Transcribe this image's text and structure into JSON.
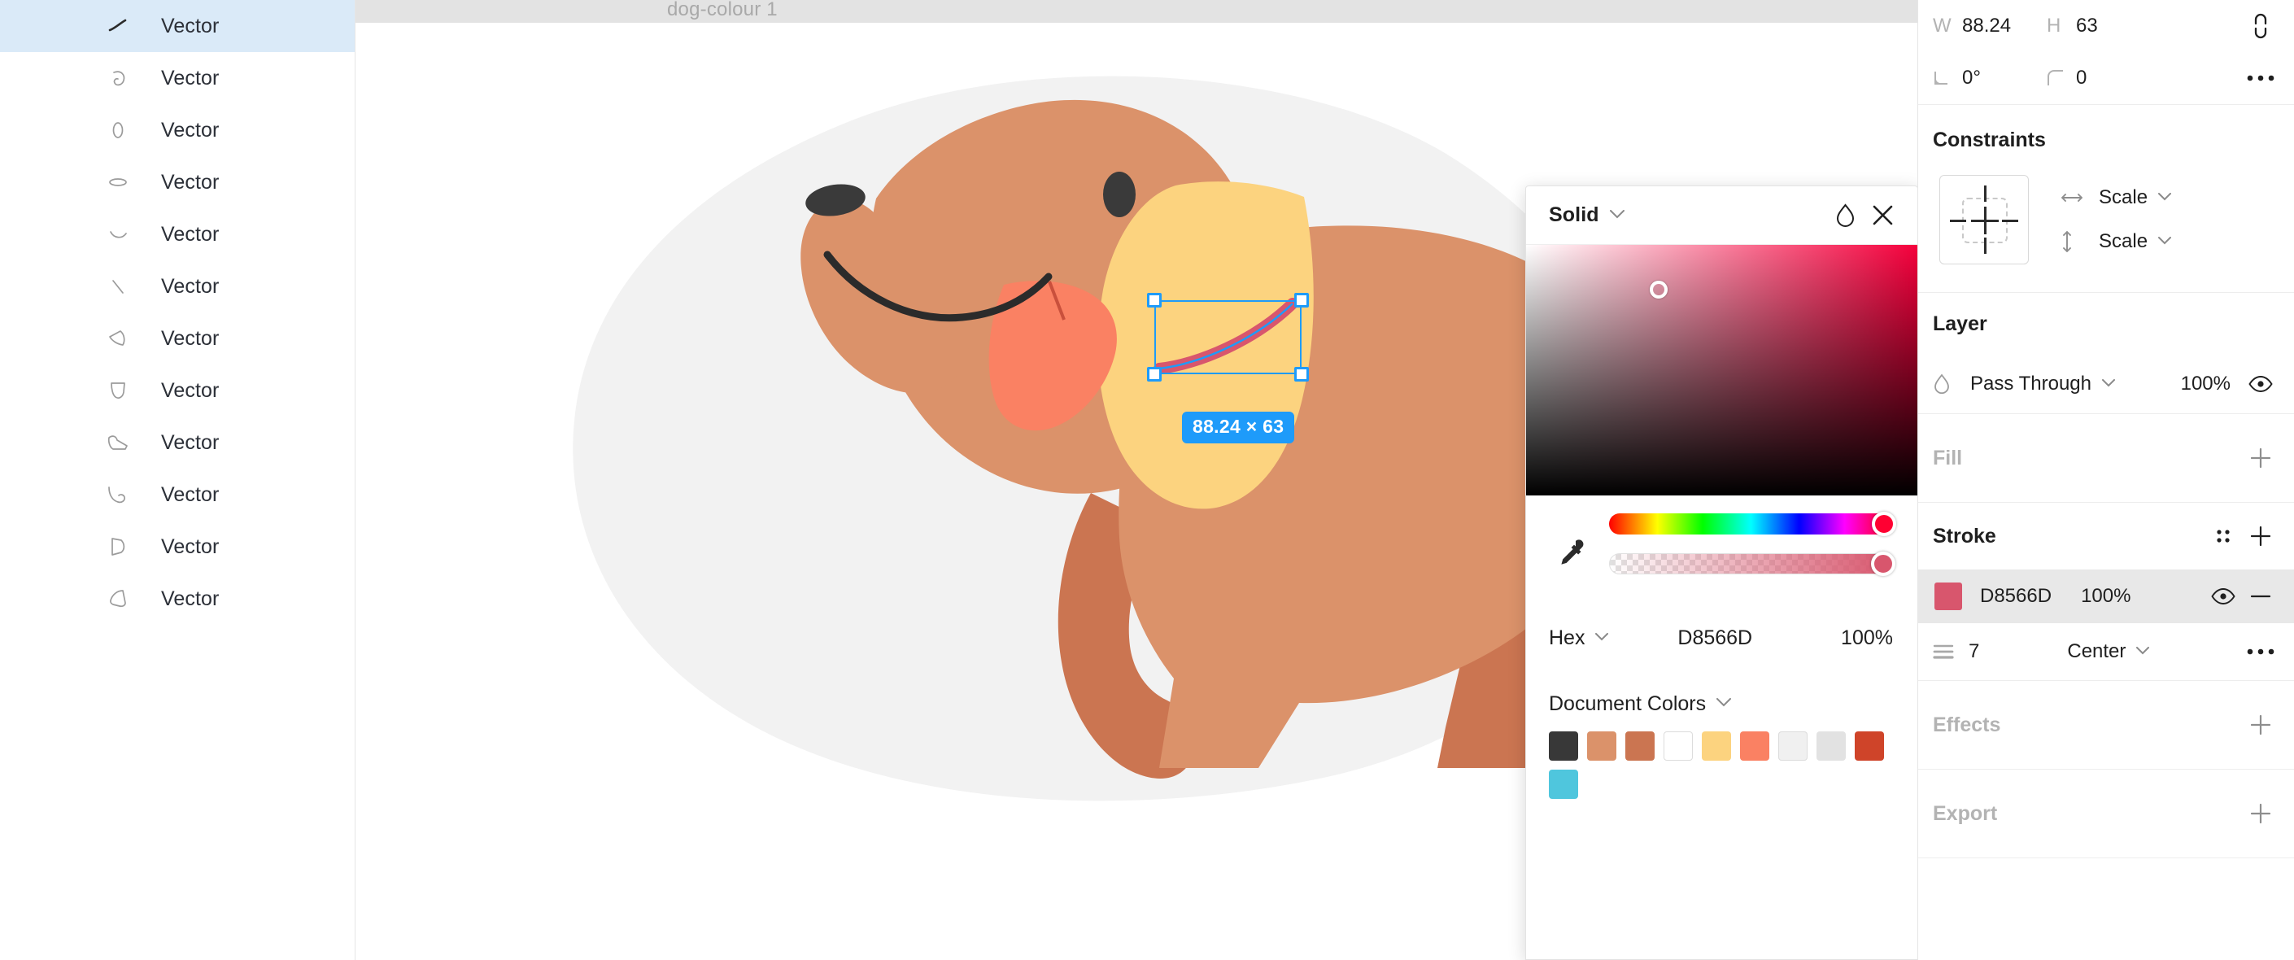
{
  "layers_panel": {
    "items": [
      {
        "name": "Vector",
        "shape": "stroke-curve",
        "selected": true
      },
      {
        "name": "Vector",
        "shape": "ear-curl",
        "selected": false
      },
      {
        "name": "Vector",
        "shape": "small-oval",
        "selected": false
      },
      {
        "name": "Vector",
        "shape": "flat-ellipse",
        "selected": false
      },
      {
        "name": "Vector",
        "shape": "smile-arc",
        "selected": false
      },
      {
        "name": "Vector",
        "shape": "diagonal-line",
        "selected": false
      },
      {
        "name": "Vector",
        "shape": "wedge",
        "selected": false
      },
      {
        "name": "Vector",
        "shape": "shield",
        "selected": false
      },
      {
        "name": "Vector",
        "shape": "paw-leg",
        "selected": false
      },
      {
        "name": "Vector",
        "shape": "hook-leg",
        "selected": false
      },
      {
        "name": "Vector",
        "shape": "flag-quad",
        "selected": false
      },
      {
        "name": "Vector",
        "shape": "blob-quad",
        "selected": false
      }
    ]
  },
  "canvas": {
    "frame_label": "dog-colour 1",
    "selection_size_badge": "88.24 × 63",
    "background": "#E3E3E3",
    "artboard_background": "#FFFFFF",
    "selection_color": "#1E9BFA",
    "illustration": {
      "name": "dog-colour",
      "blob_color": "#F2F2F2",
      "body_color": "#DB926A",
      "shade_color": "#CB7551",
      "ear_color": "#FCD37F",
      "tongue_color": "#FA8163",
      "nose_color": "#3A3A3A",
      "eye_color": "#3A3A3A",
      "mouth_color": "#2B2B2B",
      "collar_color": "#D8566D"
    }
  },
  "color_picker": {
    "type_label": "Solid",
    "eyedropper_icon": "eyedropper-icon",
    "droplet_icon": "droplet-icon",
    "close_icon": "close-icon",
    "hex_mode_label": "Hex",
    "hex_value": "D8566D",
    "alpha_value": "100%",
    "document_colors_label": "Document Colors",
    "swatches": [
      {
        "hex": "#383838",
        "bordered": false
      },
      {
        "hex": "#DB926A",
        "bordered": false
      },
      {
        "hex": "#CB7551",
        "bordered": false
      },
      {
        "hex": "#FFFFFF",
        "bordered": true
      },
      {
        "hex": "#FCD37F",
        "bordered": false
      },
      {
        "hex": "#FA8163",
        "bordered": false
      },
      {
        "hex": "#F0F0F0",
        "bordered": true
      },
      {
        "hex": "#E2E2E2",
        "bordered": false
      },
      {
        "hex": "#CF4429",
        "bordered": false
      },
      {
        "hex": "#4FC6DD",
        "bordered": false
      }
    ]
  },
  "properties": {
    "dimensions": {
      "width_label": "W",
      "width_value": "88.24",
      "height_label": "H",
      "height_value": "63",
      "rotation_value": "0°",
      "corner_radius_value": "0"
    },
    "constraints": {
      "title": "Constraints",
      "horizontal_value": "Scale",
      "vertical_value": "Scale"
    },
    "layer": {
      "title": "Layer",
      "blend_mode": "Pass Through",
      "opacity": "100%"
    },
    "fill": {
      "title": "Fill"
    },
    "stroke": {
      "title": "Stroke",
      "items": [
        {
          "hex": "D8566D",
          "swatch": "#D8566D",
          "opacity": "100%"
        }
      ],
      "weight": "7",
      "alignment": "Center"
    },
    "effects": {
      "title": "Effects"
    },
    "export": {
      "title": "Export"
    }
  }
}
